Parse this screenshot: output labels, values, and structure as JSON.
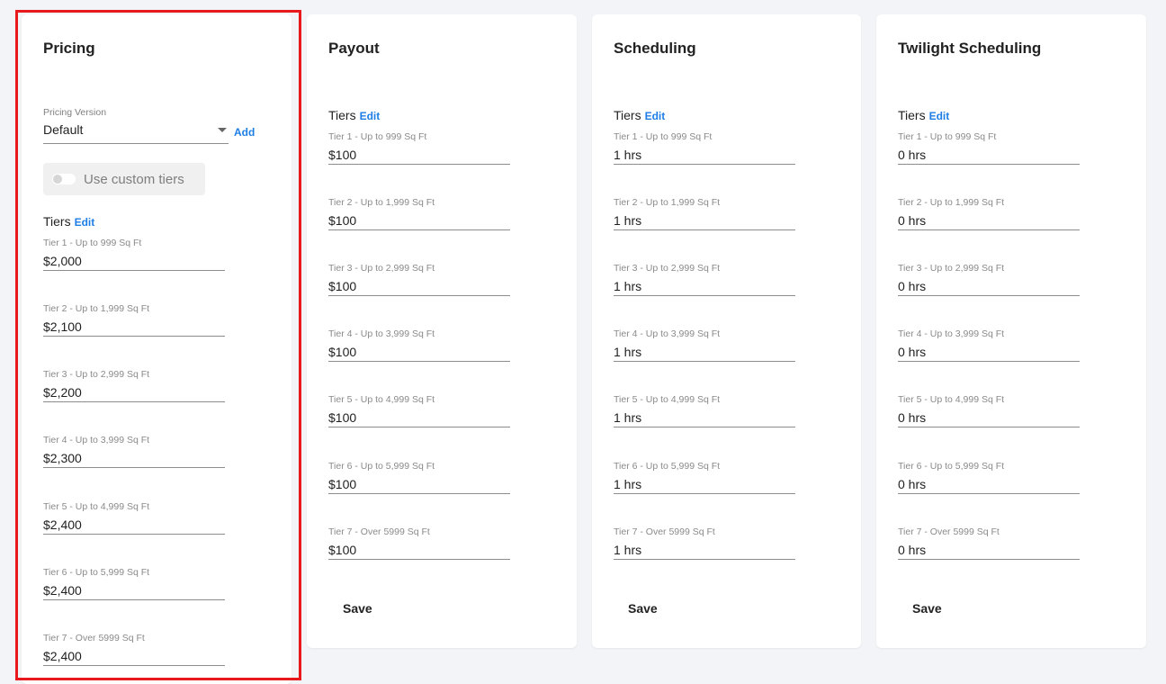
{
  "cards": {
    "pricing": {
      "title": "Pricing",
      "pricing_version_label": "Pricing Version",
      "pricing_version_value": "Default",
      "add_label": "Add",
      "custom_tiers_label": "Use custom tiers",
      "tiers_label": "Tiers",
      "edit_label": "Edit",
      "tiers": [
        {
          "label": "Tier 1 - Up to 999 Sq Ft",
          "value": "$2,000"
        },
        {
          "label": "Tier 2 - Up to 1,999 Sq Ft",
          "value": "$2,100"
        },
        {
          "label": "Tier 3 - Up to 2,999 Sq Ft",
          "value": "$2,200"
        },
        {
          "label": "Tier 4 - Up to 3,999 Sq Ft",
          "value": "$2,300"
        },
        {
          "label": "Tier 5 - Up to 4,999 Sq Ft",
          "value": "$2,400"
        },
        {
          "label": "Tier 6 - Up to 5,999 Sq Ft",
          "value": "$2,400"
        },
        {
          "label": "Tier 7 - Over 5999 Sq Ft",
          "value": "$2,400"
        }
      ]
    },
    "payout": {
      "title": "Payout",
      "tiers_label": "Tiers",
      "edit_label": "Edit",
      "save_label": "Save",
      "tiers": [
        {
          "label": "Tier 1 - Up to 999 Sq Ft",
          "value": "$100"
        },
        {
          "label": "Tier 2 - Up to 1,999 Sq Ft",
          "value": "$100"
        },
        {
          "label": "Tier 3 - Up to 2,999 Sq Ft",
          "value": "$100"
        },
        {
          "label": "Tier 4 - Up to 3,999 Sq Ft",
          "value": "$100"
        },
        {
          "label": "Tier 5 - Up to 4,999 Sq Ft",
          "value": "$100"
        },
        {
          "label": "Tier 6 - Up to 5,999 Sq Ft",
          "value": "$100"
        },
        {
          "label": "Tier 7 - Over 5999 Sq Ft",
          "value": "$100"
        }
      ]
    },
    "scheduling": {
      "title": "Scheduling",
      "tiers_label": "Tiers",
      "edit_label": "Edit",
      "save_label": "Save",
      "tiers": [
        {
          "label": "Tier 1 - Up to 999 Sq Ft",
          "value": "1 hrs"
        },
        {
          "label": "Tier 2 - Up to 1,999 Sq Ft",
          "value": "1 hrs"
        },
        {
          "label": "Tier 3 - Up to 2,999 Sq Ft",
          "value": "1 hrs"
        },
        {
          "label": "Tier 4 - Up to 3,999 Sq Ft",
          "value": "1 hrs"
        },
        {
          "label": "Tier 5 - Up to 4,999 Sq Ft",
          "value": "1 hrs"
        },
        {
          "label": "Tier 6 - Up to 5,999 Sq Ft",
          "value": "1 hrs"
        },
        {
          "label": "Tier 7 - Over 5999 Sq Ft",
          "value": "1 hrs"
        }
      ]
    },
    "twilight": {
      "title": "Twilight Scheduling",
      "tiers_label": "Tiers",
      "edit_label": "Edit",
      "save_label": "Save",
      "tiers": [
        {
          "label": "Tier 1 - Up to 999 Sq Ft",
          "value": "0 hrs"
        },
        {
          "label": "Tier 2 - Up to 1,999 Sq Ft",
          "value": "0 hrs"
        },
        {
          "label": "Tier 3 - Up to 2,999 Sq Ft",
          "value": "0 hrs"
        },
        {
          "label": "Tier 4 - Up to 3,999 Sq Ft",
          "value": "0 hrs"
        },
        {
          "label": "Tier 5 - Up to 4,999 Sq Ft",
          "value": "0 hrs"
        },
        {
          "label": "Tier 6 - Up to 5,999 Sq Ft",
          "value": "0 hrs"
        },
        {
          "label": "Tier 7 - Over 5999 Sq Ft",
          "value": "0 hrs"
        }
      ]
    }
  },
  "colors": {
    "accent": "#1e7ee6",
    "highlight": "#e8191d",
    "background": "#f3f4f7"
  }
}
